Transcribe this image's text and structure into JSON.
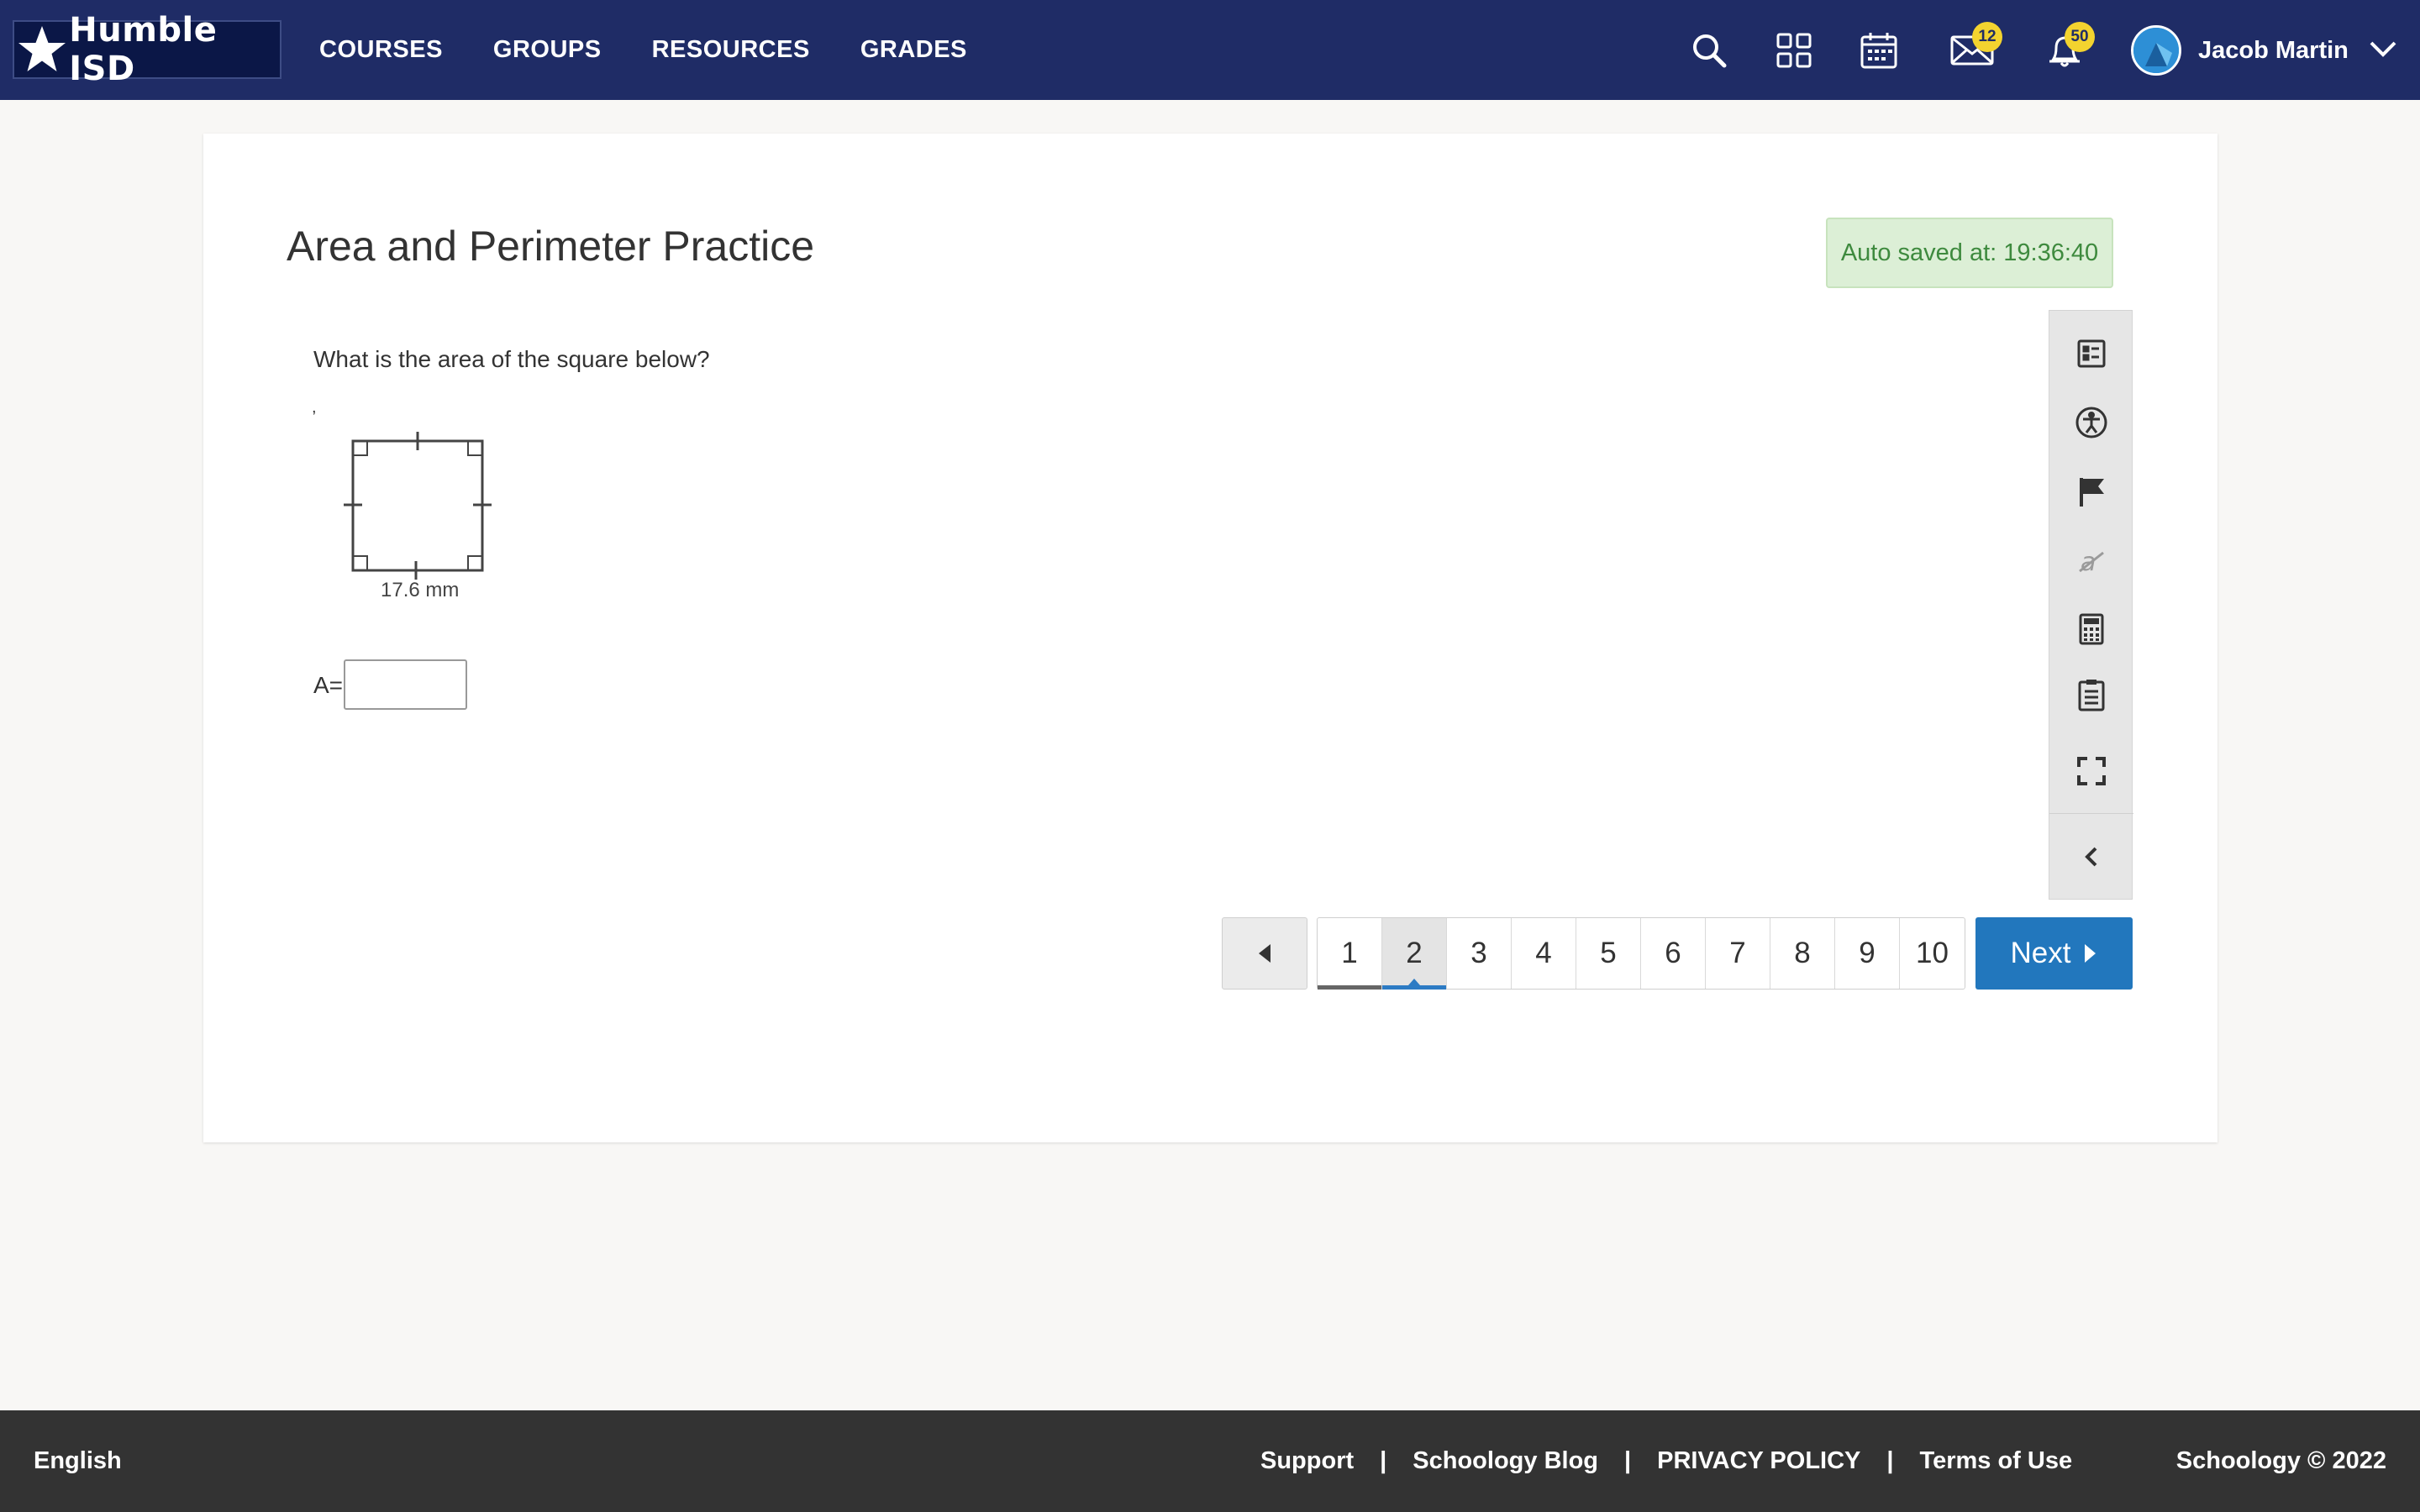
{
  "header": {
    "logo_text": "Humble ISD",
    "nav": [
      "COURSES",
      "GROUPS",
      "RESOURCES",
      "GRADES"
    ],
    "messages_count": "12",
    "notifications_count": "50",
    "user_name": "Jacob Martin",
    "icons": [
      "search-icon",
      "apps-grid-icon",
      "calendar-icon",
      "mail-icon",
      "bell-icon",
      "chevron-down-icon"
    ]
  },
  "assessment": {
    "title": "Area and Perimeter Practice",
    "autosave": "Auto saved at: 19:36:40",
    "question": "What is the area of the square below?",
    "stray_mark": ",",
    "figure_label": "17.6 mm",
    "answer_label": "A=",
    "answer_value": ""
  },
  "toolbar": {
    "tools": [
      "question-list-icon",
      "accessibility-icon",
      "flag-icon",
      "eliminate-icon",
      "calculator-icon",
      "notepad-icon",
      "fullscreen-icon",
      "collapse-icon"
    ]
  },
  "pagination": {
    "pages": [
      "1",
      "2",
      "3",
      "4",
      "5",
      "6",
      "7",
      "8",
      "9",
      "10"
    ],
    "current_page": "2",
    "next_label": "Next"
  },
  "footer": {
    "language": "English",
    "links": [
      "Support",
      "Schoology Blog",
      "PRIVACY POLICY",
      "Terms of Use"
    ],
    "separator": "|",
    "copyright": "Schoology © 2022"
  },
  "colors": {
    "header_bg": "#1f2c66",
    "badge": "#f3d32f",
    "accent_blue": "#2277bd",
    "autosave_bg": "#dcefd6",
    "autosave_text": "#3e8a3e",
    "footer_bg": "#333333"
  }
}
